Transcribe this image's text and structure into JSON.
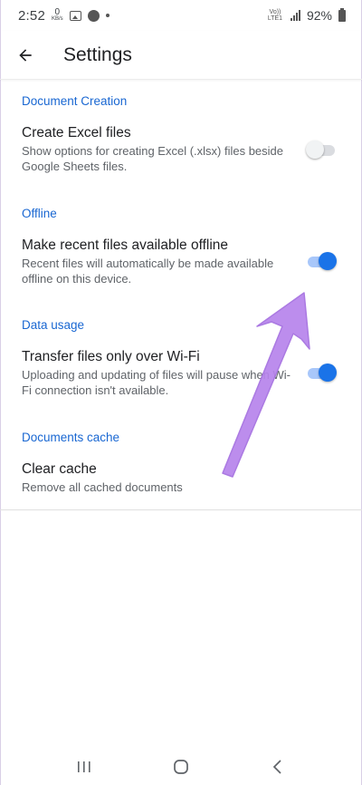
{
  "status_bar": {
    "time": "2:52",
    "speed_value": "0",
    "speed_unit": "KB/s",
    "network_label": "Vo)) LTE1",
    "battery": "92%"
  },
  "app_bar": {
    "title": "Settings",
    "back_icon": "arrow-back-icon"
  },
  "sections": [
    {
      "header": "Document Creation",
      "items": [
        {
          "title": "Create Excel files",
          "description": "Show options for creating Excel (.xlsx) files beside Google Sheets files.",
          "enabled": false
        }
      ]
    },
    {
      "header": "Offline",
      "items": [
        {
          "title": "Make recent files available offline",
          "description": "Recent files will automatically be made available offline on this device.",
          "enabled": true
        }
      ]
    },
    {
      "header": "Data usage",
      "items": [
        {
          "title": "Transfer files only over Wi-Fi",
          "description": "Uploading and updating of files will pause when Wi-Fi connection isn't available.",
          "enabled": true
        }
      ]
    },
    {
      "header": "Documents cache",
      "items": [
        {
          "title": "Clear cache",
          "description": "Remove all cached documents"
        }
      ]
    }
  ],
  "colors": {
    "accent": "#1a73e8",
    "section_header": "#1967d2",
    "annotation_arrow": "#b07ee8"
  },
  "nav_bar": {
    "icons": [
      "recent-apps-icon",
      "home-icon",
      "back-icon"
    ]
  }
}
